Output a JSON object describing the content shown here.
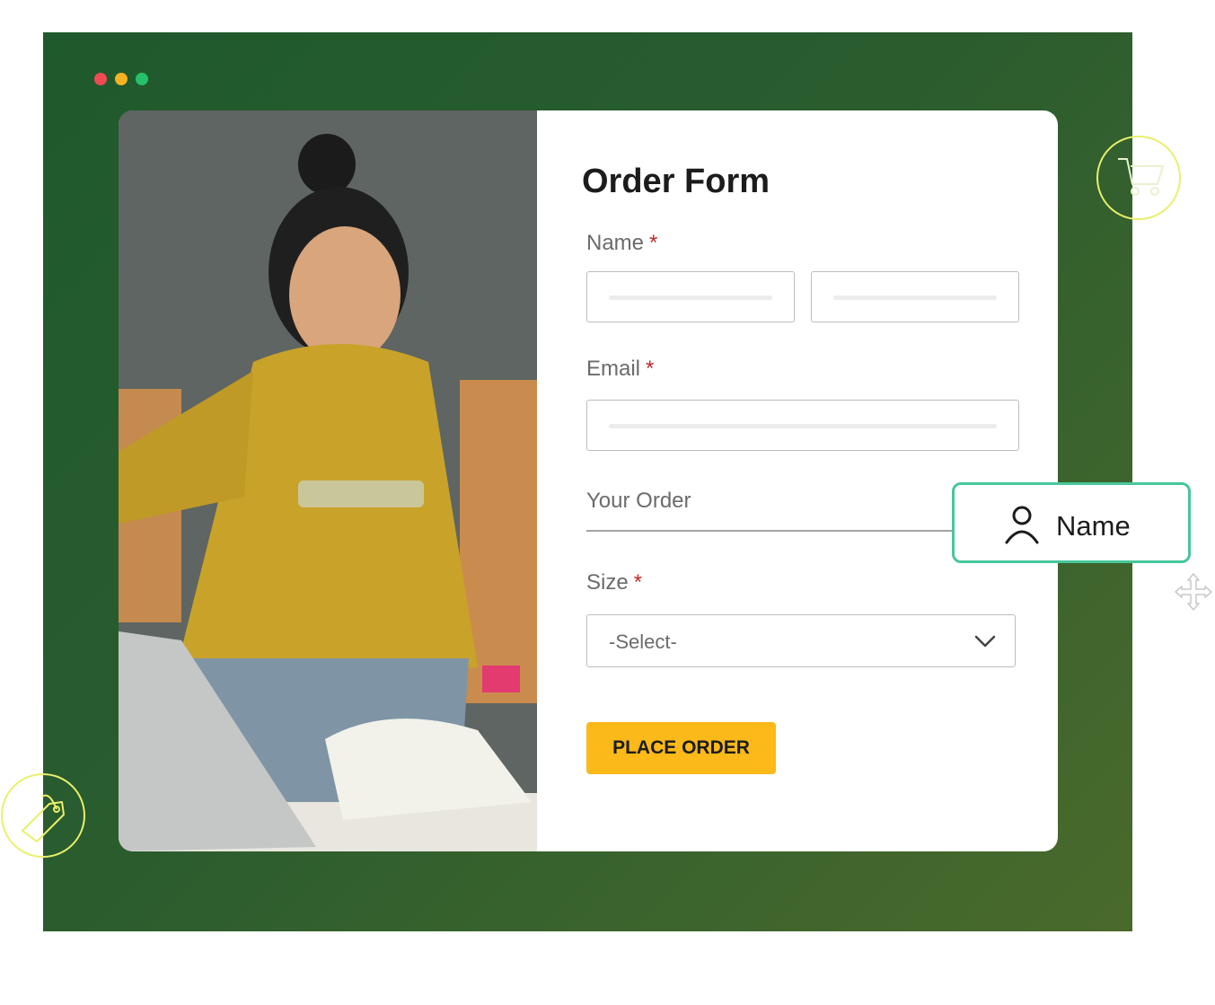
{
  "window": {
    "dots": [
      "#f04b52",
      "#f5b323",
      "#26c06a"
    ]
  },
  "form": {
    "title": "Order Form",
    "name_label": "Name",
    "email_label": "Email",
    "order_label": "Your Order",
    "size_label": "Size",
    "required_mark": "*",
    "size_select": {
      "value": "-Select-"
    },
    "submit_label": "PLACE ORDER"
  },
  "floating_badge": {
    "label": "Name",
    "icon": "user-icon"
  },
  "decor_icons": [
    "shopping-cart-icon",
    "price-tag-icon",
    "move-arrows-icon"
  ],
  "colors": {
    "accent": "#fbb91a",
    "badge_border": "#46c79a",
    "background": "#245a2d",
    "required": "#c62828"
  }
}
